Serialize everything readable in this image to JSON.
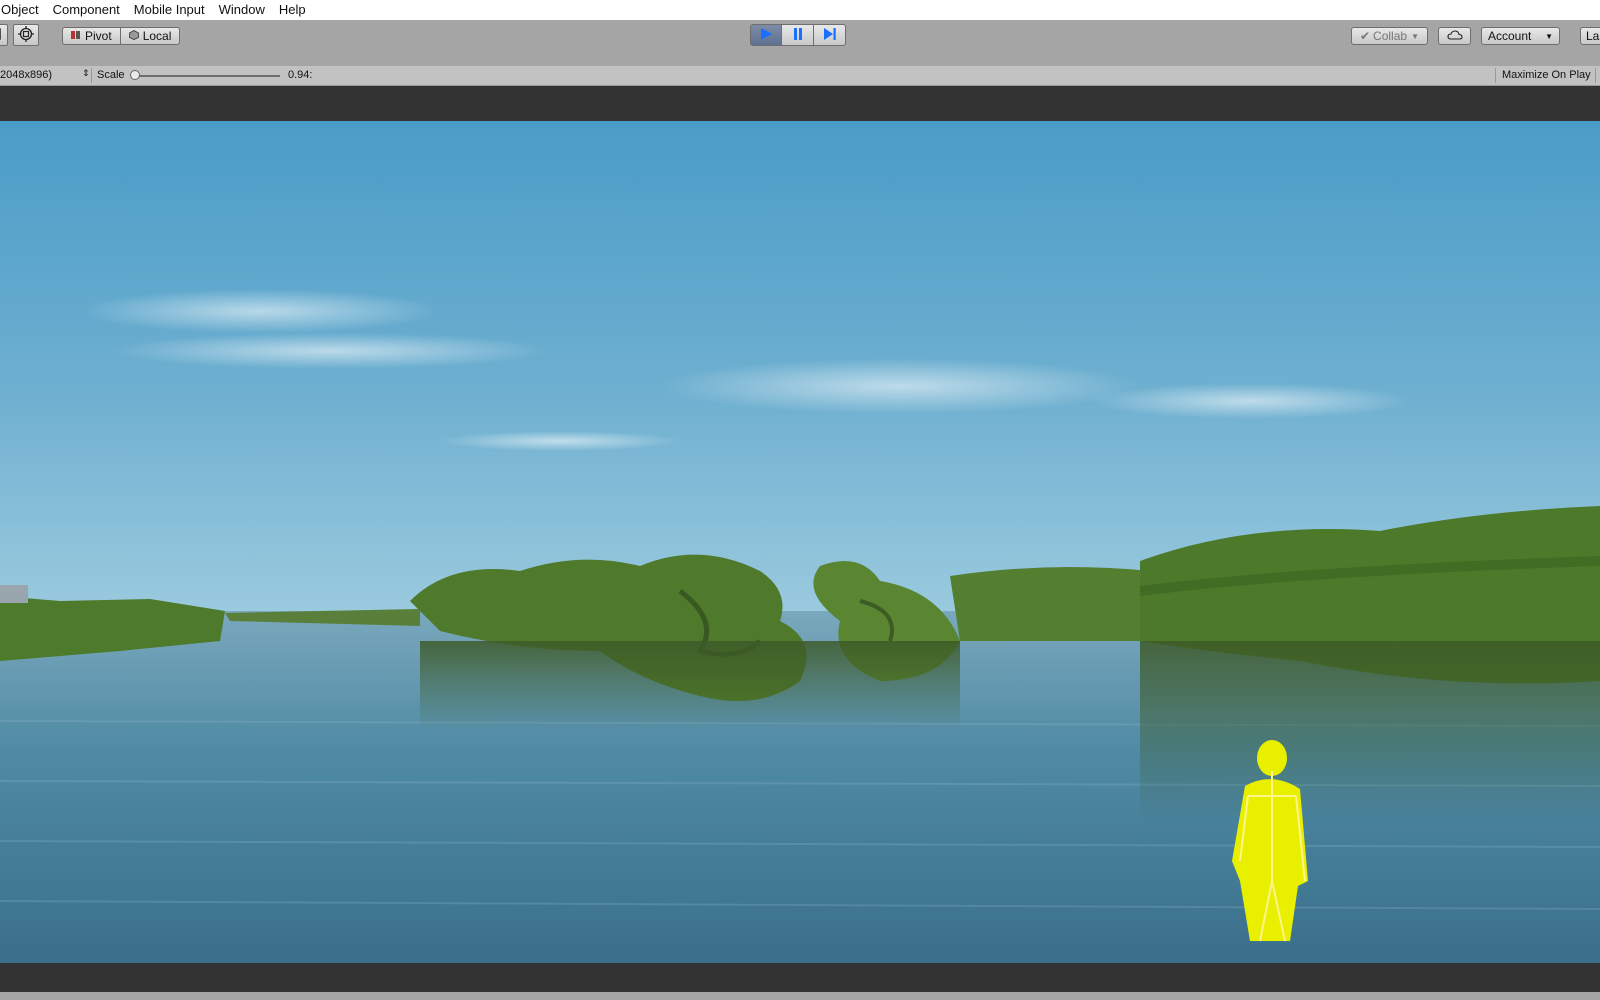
{
  "menu": {
    "items": [
      "Object",
      "Component",
      "Mobile Input",
      "Window",
      "Help"
    ]
  },
  "toolbar": {
    "pivot_label": "Pivot",
    "local_label": "Local",
    "collab_label": "Collab",
    "account_label": "Account",
    "layers_label": "La",
    "icons": {
      "rect_tool": "rect-tool-icon",
      "transform_tool": "transform-tool-icon",
      "pivot": "pivot-icon",
      "local": "local-icon",
      "play": "play-icon",
      "pause": "pause-icon",
      "step": "step-icon",
      "collab_check": "check-icon",
      "cloud": "cloud-icon"
    },
    "play_active": true
  },
  "game_view": {
    "resolution": "2048x896)",
    "scale_label": "Scale",
    "scale_value": "0.94:",
    "maximize_label": "Maximize On Play"
  },
  "colors": {
    "toolbar_bg": "#a5a5a5",
    "play_active": "#1a6fff",
    "figure_yellow": "#e8f000",
    "sky": "#5fa8cf",
    "water": "#4c7f98",
    "reeds": "#4f7a2c"
  }
}
